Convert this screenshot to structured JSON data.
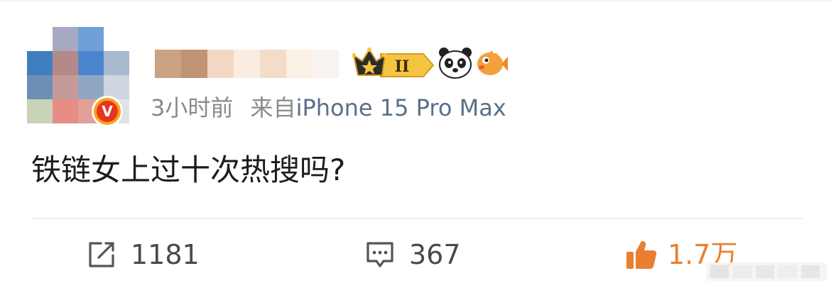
{
  "post": {
    "time": "3小时前",
    "source_prefix": "来自",
    "device": "iPhone 15 Pro Max",
    "text": "铁链女上过十次热搜吗?",
    "badges": {
      "vip_level": "II"
    }
  },
  "actions": {
    "repost_count": "1181",
    "comment_count": "367",
    "like_count": "1.7万"
  },
  "colors": {
    "accent_like": "#e87f31",
    "verified_outer": "#f8a21a",
    "verified_inner": "#e8351e",
    "meta_text": "#8a8a8a",
    "device_text": "#5a6f8a"
  },
  "icons": {
    "repost": "repost-icon",
    "comment": "comment-icon",
    "like": "thumbs-up-icon",
    "verified": "verified-v-badge-icon",
    "crown": "crown-icon",
    "panda": "panda-icon",
    "fish": "pufferfish-icon"
  }
}
